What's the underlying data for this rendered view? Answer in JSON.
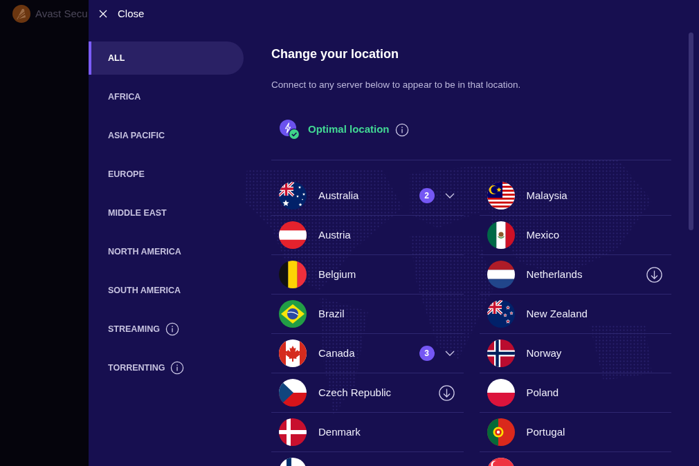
{
  "background_window": {
    "title": "Avast Secu"
  },
  "close_button": {
    "label": "Close"
  },
  "sidebar": {
    "items": [
      {
        "label": "ALL",
        "selected": true,
        "info": false
      },
      {
        "label": "AFRICA",
        "selected": false,
        "info": false
      },
      {
        "label": "ASIA PACIFIC",
        "selected": false,
        "info": false
      },
      {
        "label": "EUROPE",
        "selected": false,
        "info": false
      },
      {
        "label": "MIDDLE EAST",
        "selected": false,
        "info": false
      },
      {
        "label": "NORTH AMERICA",
        "selected": false,
        "info": false
      },
      {
        "label": "SOUTH AMERICA",
        "selected": false,
        "info": false
      },
      {
        "label": "STREAMING",
        "selected": false,
        "info": true
      },
      {
        "label": "TORRENTING",
        "selected": false,
        "info": true
      }
    ]
  },
  "main": {
    "title": "Change your location",
    "subtitle": "Connect to any server below to appear to be in that location.",
    "optimal_location": {
      "label": "Optimal location"
    }
  },
  "countries": {
    "columns": [
      [
        {
          "name": "Australia",
          "kind": "au",
          "count": "2",
          "expanded": false,
          "download": false
        },
        {
          "name": "Austria",
          "kind": "at",
          "download": false
        },
        {
          "name": "Belgium",
          "kind": "be",
          "download": false
        },
        {
          "name": "Brazil",
          "kind": "br",
          "download": false
        },
        {
          "name": "Canada",
          "kind": "ca",
          "count": "3",
          "expanded": false,
          "download": false
        },
        {
          "name": "Czech Republic",
          "kind": "cz",
          "download": true
        },
        {
          "name": "Denmark",
          "kind": "dk",
          "download": false
        },
        {
          "kind": "fi"
        }
      ],
      [
        {
          "name": "Malaysia",
          "kind": "my",
          "download": false
        },
        {
          "name": "Mexico",
          "kind": "mx",
          "download": false
        },
        {
          "name": "Netherlands",
          "kind": "nl",
          "download": true
        },
        {
          "name": "New Zealand",
          "kind": "nz",
          "download": false
        },
        {
          "name": "Norway",
          "kind": "no",
          "download": false
        },
        {
          "name": "Poland",
          "kind": "pl",
          "download": false
        },
        {
          "name": "Portugal",
          "kind": "pt",
          "download": false
        },
        {
          "kind": "sg"
        }
      ]
    ]
  }
}
